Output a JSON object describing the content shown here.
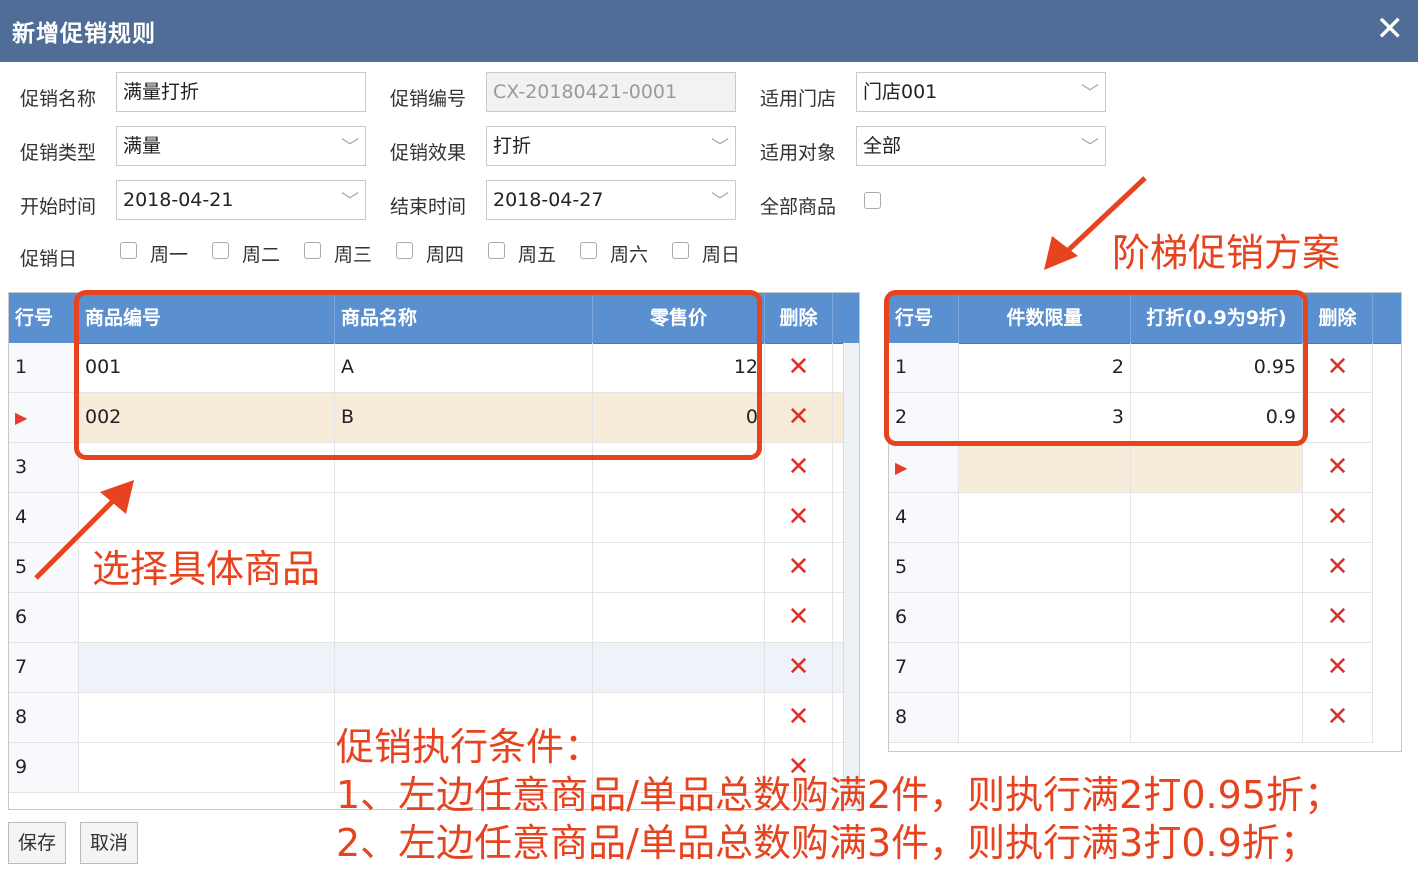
{
  "dialog": {
    "title": "新增促销规则",
    "close_icon": "close-icon"
  },
  "form": {
    "name_label": "促销名称",
    "name_value": "满量打折",
    "code_label": "促销编号",
    "code_value": "CX-20180421-0001",
    "store_label": "适用门店",
    "store_value": "门店001",
    "type_label": "促销类型",
    "type_value": "满量",
    "effect_label": "促销效果",
    "effect_value": "打折",
    "target_label": "适用对象",
    "target_value": "全部",
    "start_label": "开始时间",
    "start_value": "2018-04-21",
    "end_label": "结束时间",
    "end_value": "2018-04-27",
    "all_goods_label": "全部商品",
    "day_label": "促销日",
    "days": [
      "周一",
      "周二",
      "周三",
      "周四",
      "周五",
      "周六",
      "周日"
    ]
  },
  "left_grid": {
    "headers": {
      "row_no": "行号",
      "code": "商品编号",
      "name": "商品名称",
      "price": "零售价",
      "delete": "删除"
    },
    "rows": [
      {
        "no": "1",
        "code": "001",
        "name": "A",
        "price": "12"
      },
      {
        "no": "",
        "code": "002",
        "name": "B",
        "price": "0"
      },
      {
        "no": "3",
        "code": "",
        "name": "",
        "price": ""
      },
      {
        "no": "4",
        "code": "",
        "name": "",
        "price": ""
      },
      {
        "no": "5",
        "code": "",
        "name": "",
        "price": ""
      },
      {
        "no": "6",
        "code": "",
        "name": "",
        "price": ""
      },
      {
        "no": "7",
        "code": "",
        "name": "",
        "price": ""
      },
      {
        "no": "8",
        "code": "",
        "name": "",
        "price": ""
      },
      {
        "no": "9",
        "code": "",
        "name": "",
        "price": ""
      }
    ]
  },
  "right_grid": {
    "headers": {
      "row_no": "行号",
      "qty": "件数限量",
      "discount": "打折(0.9为9折)",
      "delete": "删除"
    },
    "rows": [
      {
        "no": "1",
        "qty": "2",
        "discount": "0.95"
      },
      {
        "no": "2",
        "qty": "3",
        "discount": "0.9"
      },
      {
        "no": "",
        "qty": "",
        "discount": ""
      },
      {
        "no": "4",
        "qty": "",
        "discount": ""
      },
      {
        "no": "5",
        "qty": "",
        "discount": ""
      },
      {
        "no": "6",
        "qty": "",
        "discount": ""
      },
      {
        "no": "7",
        "qty": "",
        "discount": ""
      },
      {
        "no": "8",
        "qty": "",
        "discount": ""
      }
    ]
  },
  "buttons": {
    "save": "保存",
    "cancel": "取消"
  },
  "annotations": {
    "tiered": "阶梯促销方案",
    "select_goods": "选择具体商品",
    "cond_title": "促销执行条件：",
    "cond_1": "1、左边任意商品/单品总数购满2件，则执行满2打0.95折；",
    "cond_2": "2、左边任意商品/单品总数购满3件，则执行满3打0.9折；"
  },
  "colors": {
    "titlebar": "#4f6d96",
    "grid_header": "#5a8fd0",
    "annotation": "#e7431e",
    "delete": "#d9322a",
    "selected_row": "#f6ecd9"
  }
}
